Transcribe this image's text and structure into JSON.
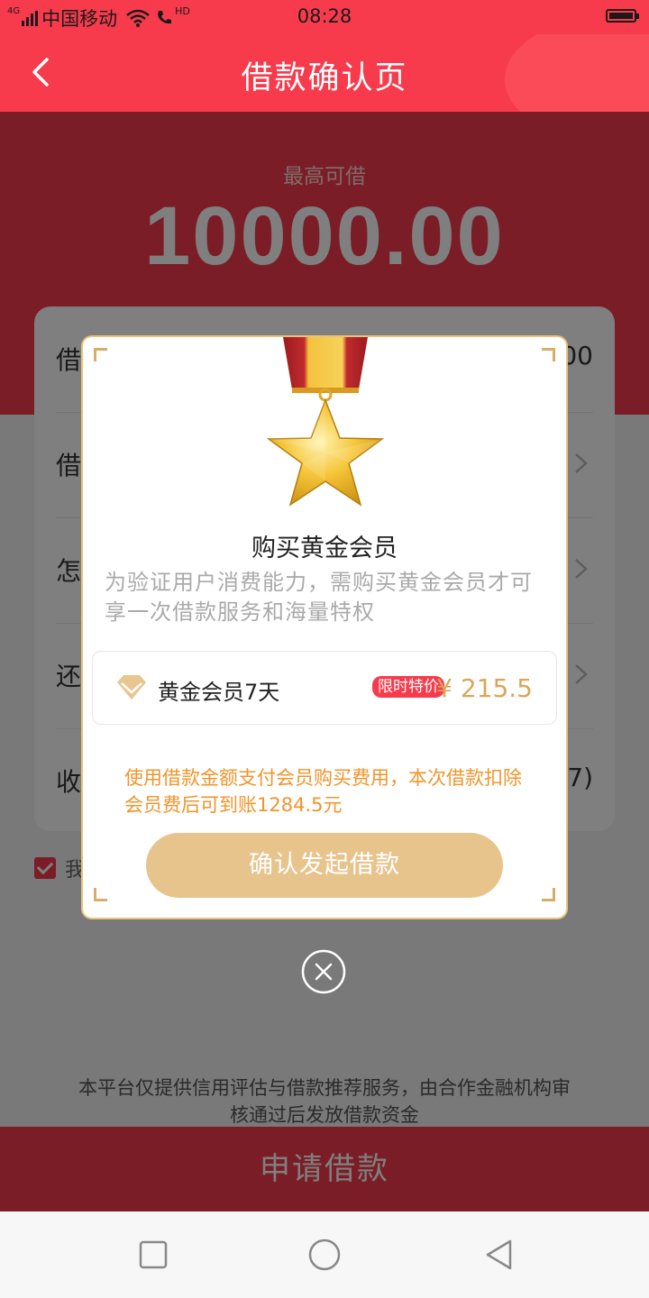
{
  "status_bar": {
    "network": "4G",
    "carrier": "中国移动",
    "call_indicator": "HD",
    "time": "08:28"
  },
  "nav": {
    "title": "借款确认页",
    "back_icon": "chevron-left-icon"
  },
  "hero": {
    "label": "最高可借",
    "amount": "10000.00"
  },
  "card": {
    "rows": [
      {
        "label": "借",
        "value": "00"
      },
      {
        "label": "借",
        "value": ""
      },
      {
        "label": "怎",
        "value": ""
      },
      {
        "label": "还",
        "value": ""
      },
      {
        "label": "收",
        "value": "7)"
      }
    ]
  },
  "agreement": {
    "text": "我"
  },
  "disclaimer": "本平台仅提供信用评估与借款推荐服务，由合作金融机构审核通过后发放借款资金",
  "apply_button": "申请借款",
  "modal": {
    "title": "购买黄金会员",
    "description": "为验证用户消费能力，需购买黄金会员才可享一次借款服务和海量特权",
    "plan": {
      "name": "黄金会员7天",
      "badge": "限时特价",
      "price": "¥ 215.5"
    },
    "note": "使用借款金额支付会员购买费用，本次借款扣除会员费后可到账1284.5元",
    "confirm_button": "确认发起借款"
  },
  "colors": {
    "brand_red": "#f73b4c",
    "gold": "#e8c48d",
    "price_gold": "#d9a65d",
    "note_orange": "#f0952b"
  }
}
